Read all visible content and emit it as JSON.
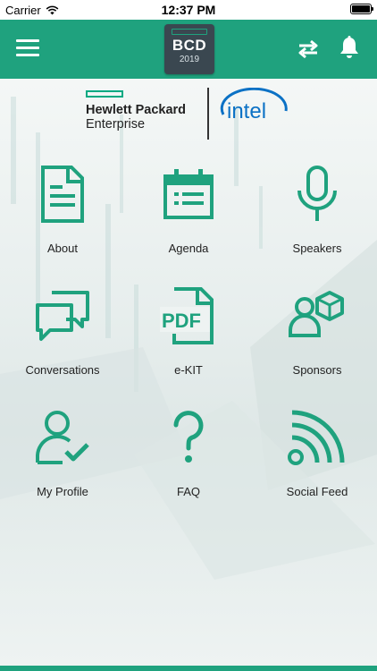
{
  "status_bar": {
    "carrier": "Carrier",
    "time": "12:37 PM"
  },
  "header": {
    "logo_abbr": "BCD",
    "logo_year": "2019"
  },
  "partners": {
    "hpe_line1": "Hewlett Packard",
    "hpe_line2": "Enterprise",
    "intel_text": "intel"
  },
  "tiles": [
    {
      "label": "About",
      "icon": "document-icon"
    },
    {
      "label": "Agenda",
      "icon": "calendar-icon"
    },
    {
      "label": "Speakers",
      "icon": "microphone-icon"
    },
    {
      "label": "Conversations",
      "icon": "chat-bubbles-icon"
    },
    {
      "label": "e-KIT",
      "icon": "pdf-icon"
    },
    {
      "label": "Sponsors",
      "icon": "user-cube-icon"
    },
    {
      "label": "My Profile",
      "icon": "user-check-icon"
    },
    {
      "label": "FAQ",
      "icon": "question-icon"
    },
    {
      "label": "Social Feed",
      "icon": "rss-icon"
    }
  ],
  "colors": {
    "accent": "#1fa27e",
    "logo_bg": "#3a4750",
    "intel_blue": "#0b71c5"
  }
}
